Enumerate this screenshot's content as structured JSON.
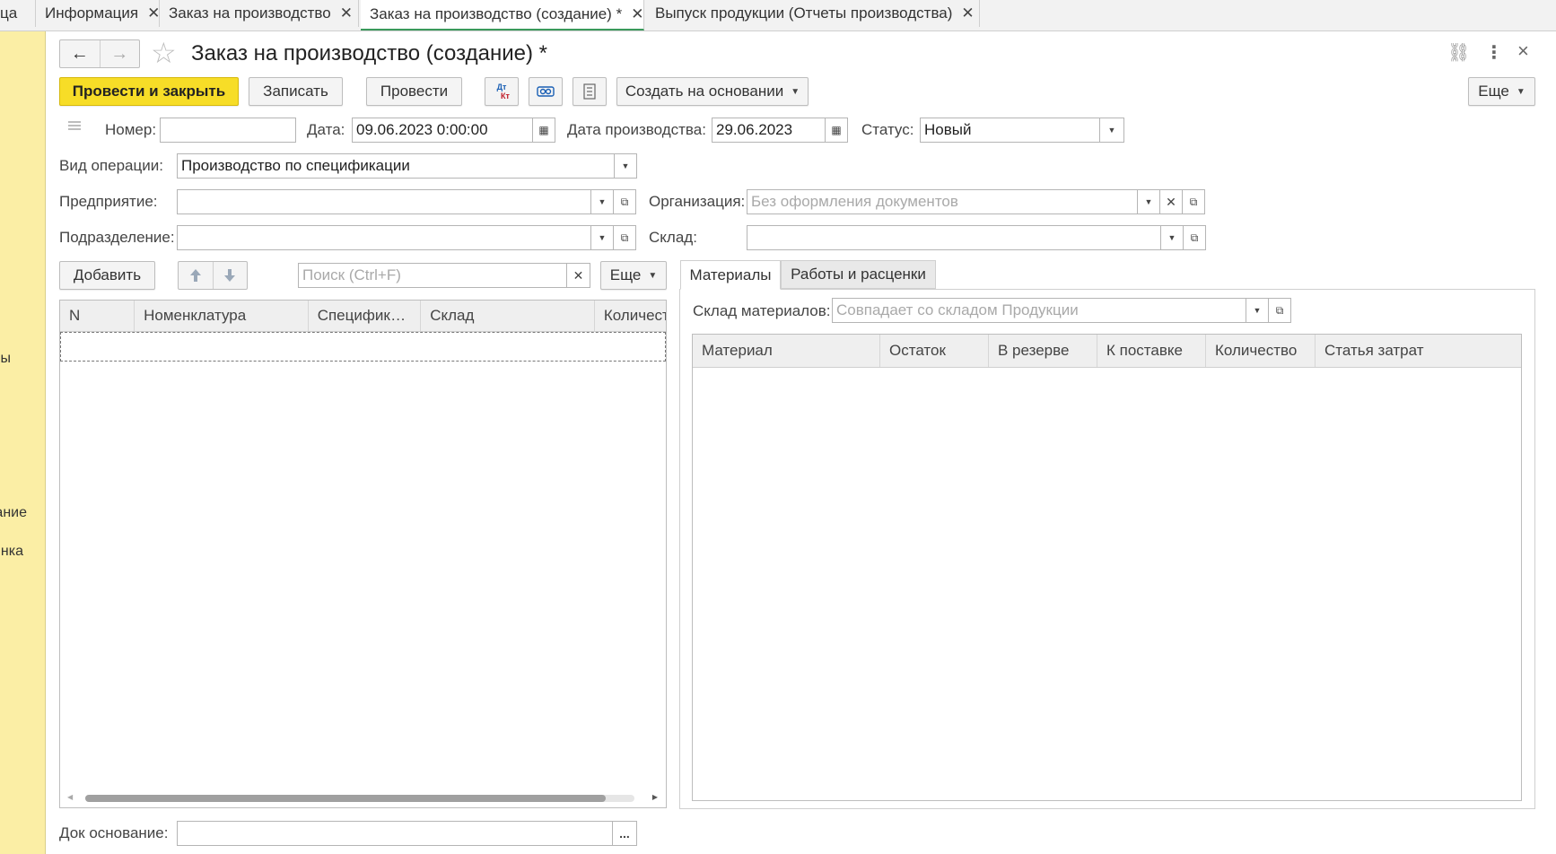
{
  "tabs": [
    {
      "label": "ца",
      "closable": false
    },
    {
      "label": "Информация",
      "closable": true
    },
    {
      "label": "Заказ на производство",
      "closable": true
    },
    {
      "label": "Заказ на производство (создание) *",
      "closable": true,
      "active": true
    },
    {
      "label": "Выпуск продукции (Отчеты производства)",
      "closable": true
    }
  ],
  "sidebar": {
    "items": [
      "ы",
      "ание",
      "нка"
    ]
  },
  "header": {
    "title": "Заказ на производство (создание) *",
    "nav_back": "←",
    "nav_forward": "→",
    "star": "☆",
    "link_icon": "⛓",
    "more_icon": "⋮",
    "close_icon": "×"
  },
  "toolbar": {
    "post_close": "Провести и закрыть",
    "save": "Записать",
    "post": "Провести",
    "dt_kt_top": "Дт",
    "dt_kt_bottom": "Кт",
    "create_based": "Создать на основании",
    "more": "Еще"
  },
  "form": {
    "number_label": "Номер:",
    "number_value": "",
    "date_label": "Дата:",
    "date_value": "09.06.2023  0:00:00",
    "prod_date_label": "Дата производства:",
    "prod_date_value": "29.06.2023",
    "status_label": "Статус:",
    "status_value": "Новый",
    "operation_label": "Вид операции:",
    "operation_value": "Производство по спецификации",
    "enterprise_label": "Предприятие:",
    "enterprise_value": "",
    "org_label": "Организация:",
    "org_placeholder": "Без оформления документов",
    "division_label": "Подразделение:",
    "division_value": "",
    "warehouse_label": "Склад:",
    "warehouse_value": "",
    "doc_base_label": "Док основание:",
    "doc_base_value": "",
    "ellipsis": "..."
  },
  "products": {
    "add": "Добавить",
    "search_placeholder": "Поиск (Ctrl+F)",
    "more": "Еще",
    "columns": [
      "N",
      "Номенклатура",
      "Спецификация",
      "Склад",
      "Количество"
    ]
  },
  "materials_panel": {
    "tabs": [
      "Материалы",
      "Работы и расценки"
    ],
    "warehouse_label": "Склад материалов:",
    "warehouse_placeholder": "Совпадает со складом Продукции",
    "columns": [
      "Материал",
      "Остаток",
      "В резерве",
      "К поставке",
      "Количество",
      "Статья затрат"
    ]
  },
  "colors": {
    "accent_yellow": "#f7dd27",
    "sidebar_bg": "#fbeea5",
    "active_tab_underline": "#3a9a5b"
  }
}
